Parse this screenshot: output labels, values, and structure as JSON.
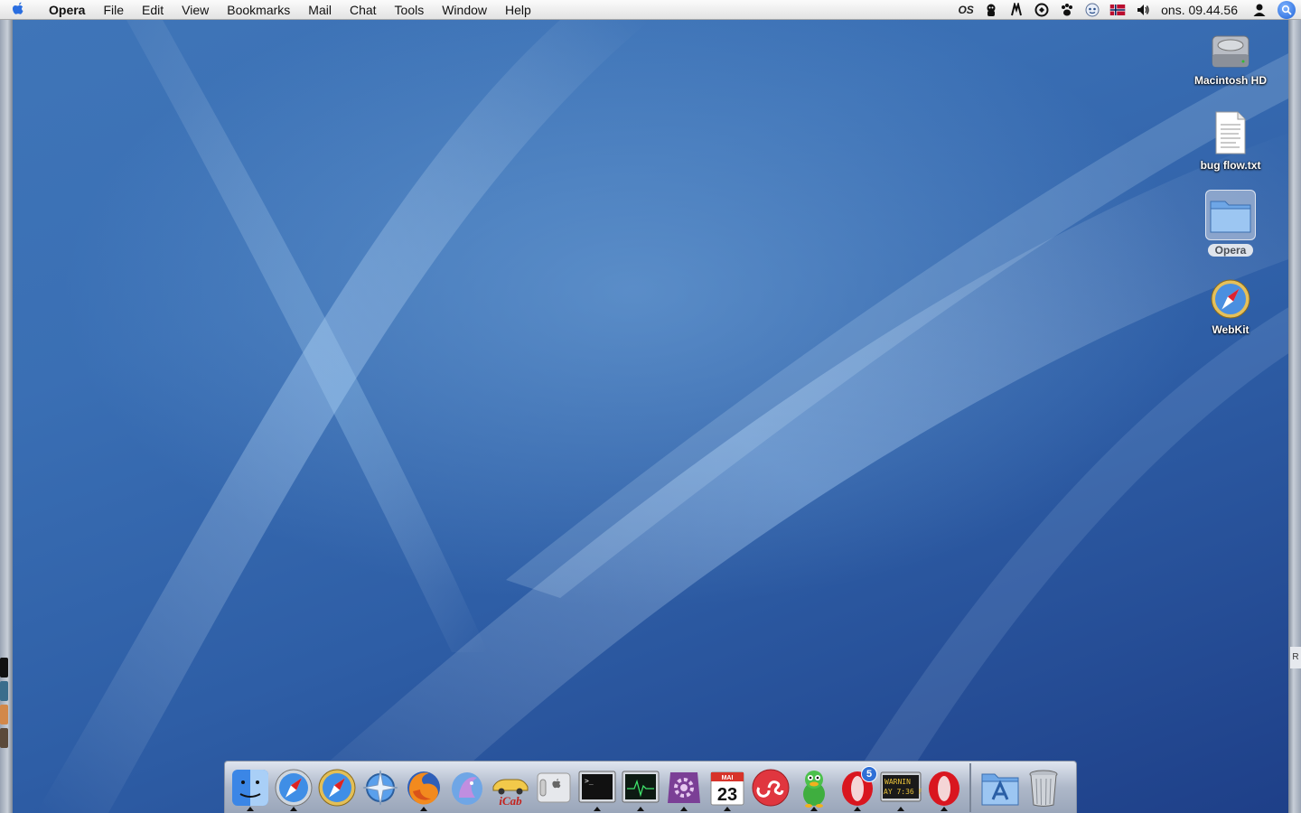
{
  "menubar": {
    "app_name": "Opera",
    "items": [
      "File",
      "Edit",
      "View",
      "Bookmarks",
      "Mail",
      "Chat",
      "Tools",
      "Window",
      "Help"
    ],
    "tray_icons": [
      "lastfm-icon",
      "growl-icon",
      "network-icon",
      "sync-icon",
      "paw-icon",
      "chat-status-icon",
      "norwegian-flag-icon",
      "volume-icon"
    ],
    "lastfm_tray_text": "OS",
    "clock": "ons. 09.44.56"
  },
  "desktop_icons": [
    {
      "name": "macintosh-hd",
      "label": "Macintosh HD",
      "icon": "hard-drive-icon"
    },
    {
      "name": "bug-flow-txt",
      "label": "bug flow.txt",
      "icon": "text-document-icon"
    },
    {
      "name": "opera-folder",
      "label": "Opera",
      "icon": "folder-icon",
      "selected": true
    },
    {
      "name": "webkit",
      "label": "WebKit",
      "icon": "compass-icon"
    }
  ],
  "dock": {
    "apps": [
      {
        "name": "finder",
        "icon": "finder-icon",
        "running": true
      },
      {
        "name": "safari",
        "icon": "safari-icon",
        "running": true
      },
      {
        "name": "webkit",
        "icon": "webkit-icon",
        "running": false
      },
      {
        "name": "camino",
        "icon": "camino-icon",
        "running": false
      },
      {
        "name": "firefox",
        "icon": "firefox-icon",
        "running": true
      },
      {
        "name": "seamonkey",
        "icon": "seamonkey-icon",
        "running": false
      },
      {
        "name": "icab",
        "icon": "icab-icon",
        "running": false
      },
      {
        "name": "system-preferences",
        "icon": "apple-switch-icon",
        "running": false
      },
      {
        "name": "terminal",
        "icon": "terminal-icon",
        "running": true
      },
      {
        "name": "activity-monitor",
        "icon": "activity-monitor-icon",
        "running": true
      },
      {
        "name": "script-editor",
        "icon": "gear-badge-icon",
        "running": true
      },
      {
        "name": "ical",
        "icon": "calendar-icon",
        "running": true
      },
      {
        "name": "lastfm",
        "icon": "lastfm-icon",
        "running": false
      },
      {
        "name": "adium",
        "icon": "duck-icon",
        "running": true
      },
      {
        "name": "opera-mail",
        "icon": "opera-icon",
        "running": true
      },
      {
        "name": "console",
        "icon": "console-icon",
        "running": true
      },
      {
        "name": "opera",
        "icon": "opera-icon",
        "running": true
      }
    ],
    "calendar_month": "MAI",
    "calendar_day": "23",
    "icab_text": "iCab",
    "opera_mail_badge": "5",
    "console_text_line1": "WARNIN",
    "console_text_line2": "AY 7:36 F",
    "right_items": [
      {
        "name": "applications-stack",
        "icon": "applications-folder-icon"
      },
      {
        "name": "trash",
        "icon": "trash-icon"
      }
    ]
  },
  "side_edge": {
    "right_label": "R"
  },
  "colors": {
    "wallpaper_top": "#3f75b8",
    "wallpaper_bottom": "#1e3f88",
    "spotlight": "#1f63d8",
    "opera_red": "#d9161f"
  }
}
